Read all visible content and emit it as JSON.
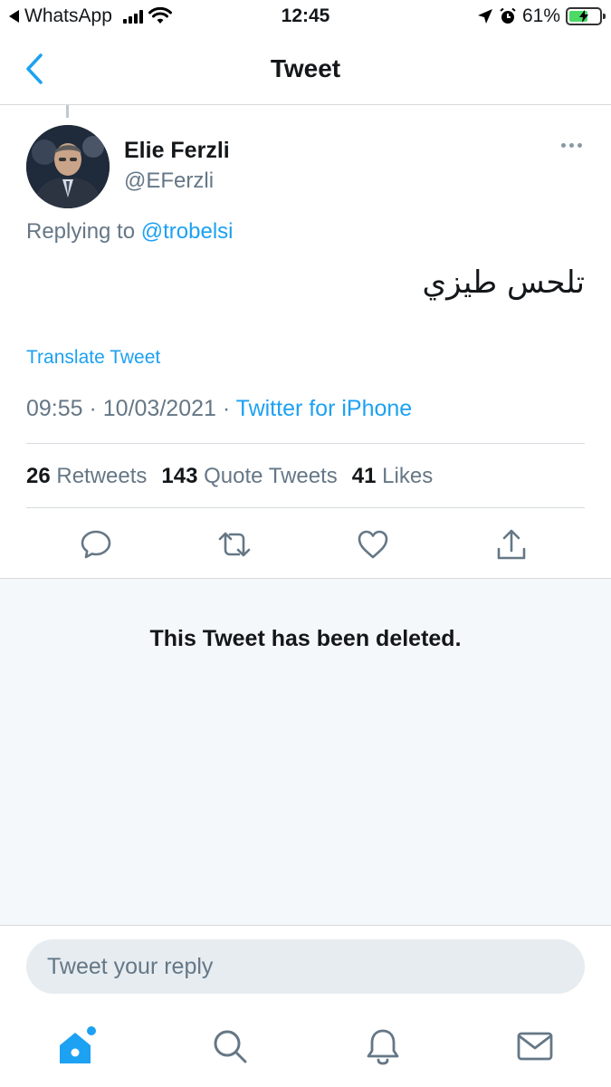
{
  "status_bar": {
    "back_app": "WhatsApp",
    "time": "12:45",
    "battery_percent": "61%",
    "battery_level": 0.61,
    "battery_color": "#4cd964"
  },
  "header": {
    "title": "Tweet",
    "back_icon": "chevron-left-icon"
  },
  "tweet": {
    "author_name": "Elie Ferzli",
    "author_handle": "@EFerzli",
    "replying_prefix": "Replying to",
    "replying_to": "@trobelsi",
    "text": "تلحس طيزي",
    "translate_label": "Translate Tweet",
    "timestamp": "09:55 · 10/03/2021 · ",
    "client": "Twitter for iPhone",
    "stats": {
      "retweets_count": "26",
      "retweets_label": "Retweets",
      "quotes_count": "143",
      "quotes_label": "Quote Tweets",
      "likes_count": "41",
      "likes_label": "Likes"
    },
    "actions": [
      "reply-icon",
      "retweet-icon",
      "like-icon",
      "share-icon"
    ]
  },
  "deleted_notice": "This Tweet has been deleted.",
  "reply": {
    "placeholder": "Tweet your reply"
  },
  "tabbar": {
    "items": [
      "home-icon",
      "search-icon",
      "notifications-icon",
      "messages-icon"
    ],
    "accent": "#1da1f2",
    "inactive": "#657786"
  },
  "colors": {
    "link": "#1da1f2",
    "secondary_text": "#657786",
    "divider": "#d6dade",
    "deleted_bg": "#f5f8fa"
  }
}
